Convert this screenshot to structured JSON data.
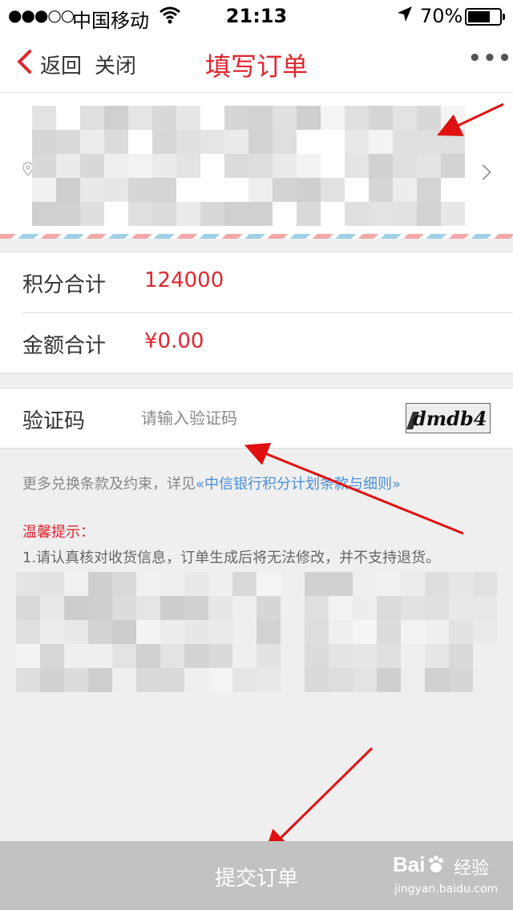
{
  "status_bar": {
    "signal": "●●●○○",
    "carrier": "中国移动",
    "time": "21:13",
    "battery": "70%",
    "battery_level": 0.7,
    "icons": [
      "wifi-icon",
      "location-arrow-icon",
      "battery-icon"
    ]
  },
  "nav": {
    "back_label": "返回",
    "close_label": "关闭",
    "title": "填写订单",
    "more_label": "•••",
    "accent_color": "#e0262f"
  },
  "summary": {
    "points_label": "积分合计",
    "points_value": "124000",
    "amount_label": "金额合计",
    "amount_value": "¥0.00"
  },
  "captcha": {
    "label": "验证码",
    "placeholder": "请输入验证码",
    "image_text": "dmdb4"
  },
  "terms": {
    "prefix": "更多兑换条款及约束，详见",
    "link": "«中信银行积分计划条款与细则»"
  },
  "tips": {
    "title": "温馨提示：",
    "line1": "1.请认真核对收货信息，订单生成后将无法修改，并不支持退货。"
  },
  "submit": {
    "label": "提交订单",
    "bg_color": "#c2c2c2"
  },
  "watermark": {
    "brand": "Bai",
    "brand_suffix": "经验",
    "url": "jingyan.baidu.com"
  }
}
